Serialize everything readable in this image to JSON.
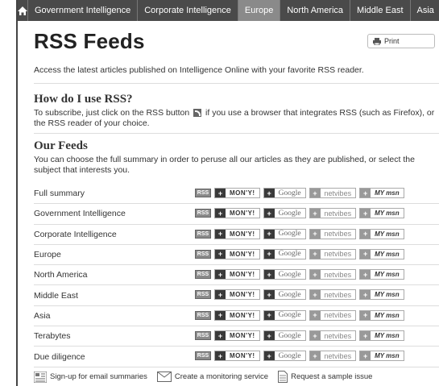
{
  "topnav": {
    "home_icon": "home-icon",
    "items": [
      "Government Intelligence",
      "Corporate Intelligence",
      "Europe",
      "North America",
      "Middle East",
      "Asia"
    ],
    "active_index": 2
  },
  "page": {
    "title": "RSS Feeds",
    "print_label": "Print",
    "intro": "Access the latest articles published on Intelligence Online with your favorite RSS reader."
  },
  "how": {
    "heading": "How do I use RSS?",
    "text_before": "To subscribe, just click on the RSS button",
    "text_after": "if you use a browser that integrates RSS (such as Firefox), or the RSS reader of your choice."
  },
  "feeds": {
    "heading": "Our Feeds",
    "text": "You can choose the full summary in order to peruse all our articles as they are published, or select the subject that interests you.",
    "rss_label": "RSS",
    "services": {
      "mony": "MON'Y!",
      "google": "Google",
      "netvibes": "netvibes",
      "msn": "MY msn"
    },
    "items": [
      "Full summary",
      "Government Intelligence",
      "Corporate Intelligence",
      "Europe",
      "North America",
      "Middle East",
      "Asia",
      "Terabytes",
      "Due diligence"
    ]
  },
  "footer": {
    "links": [
      "Sign-up for email summaries",
      "Create a monitoring service",
      "Request a sample issue"
    ]
  }
}
